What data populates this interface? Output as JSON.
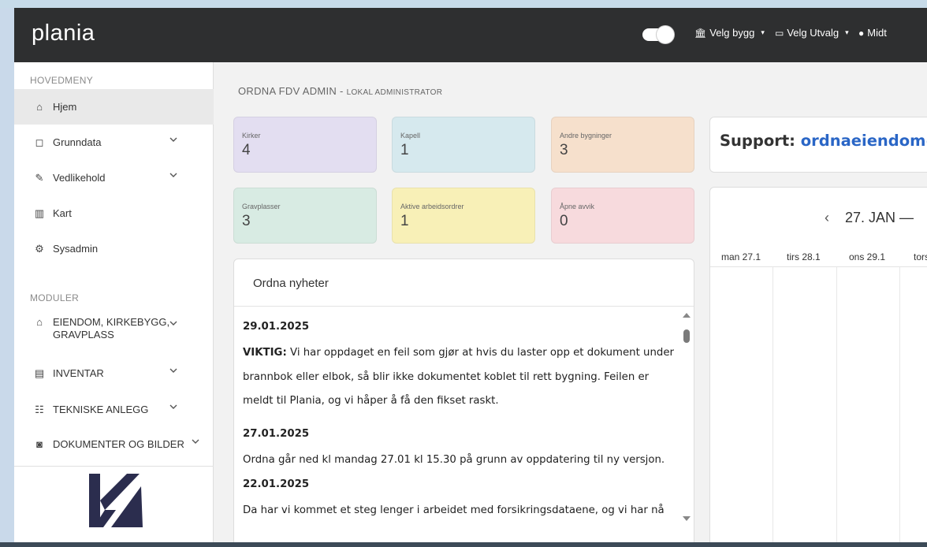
{
  "header": {
    "logo": "plania",
    "menu": [
      {
        "icon": "bank-icon",
        "glyph": "🏛",
        "label": "Velg bygg"
      },
      {
        "icon": "monitor-icon",
        "glyph": "▭",
        "label": "Velg Utvalg"
      },
      {
        "icon": "user-icon",
        "glyph": "●",
        "label": "Midt"
      }
    ]
  },
  "sidebar": {
    "main_section": "HOVEDMENY",
    "main_items": [
      {
        "icon": "home-icon",
        "glyph": "⌂",
        "label": "Hjem",
        "active": true
      },
      {
        "icon": "document-icon",
        "glyph": "◻",
        "label": "Grunndata",
        "expandable": true
      },
      {
        "icon": "wrench-icon",
        "glyph": "✎",
        "label": "Vedlikehold",
        "expandable": true
      },
      {
        "icon": "map-icon",
        "glyph": "▥",
        "label": "Kart"
      },
      {
        "icon": "gear-icon",
        "glyph": "⚙",
        "label": "Sysadmin"
      }
    ],
    "modules_section": "MODULER",
    "module_items": [
      {
        "icon": "building-icon",
        "glyph": "⌂",
        "label": "EIENDOM, KIRKEBYGG, GRAVPLASS"
      },
      {
        "icon": "inventory-icon",
        "glyph": "▤",
        "label": "INVENTAR"
      },
      {
        "icon": "hierarchy-icon",
        "glyph": "☷",
        "label": "TEKNISKE ANLEGG"
      },
      {
        "icon": "camera-icon",
        "glyph": "◙",
        "label": "DOKUMENTER OG BILDER"
      }
    ]
  },
  "main": {
    "title": "ORDNA FDV ADMIN",
    "title_sep": " - ",
    "title_role": "LOKAL ADMINISTRATOR"
  },
  "stats": [
    {
      "label": "Kirker",
      "value": "4",
      "color": "#e3def1"
    },
    {
      "label": "Kapell",
      "value": "1",
      "color": "#d6e9ee"
    },
    {
      "label": "Andre bygninger",
      "value": "3",
      "color": "#f6e0cc"
    },
    {
      "label": "Gravplasser",
      "value": "3",
      "color": "#d8ebe3"
    },
    {
      "label": "Aktive arbeidsordrer",
      "value": "1",
      "color": "#f8f0b7"
    },
    {
      "label": "Åpne avvik",
      "value": "0",
      "color": "#f7dadd"
    }
  ],
  "news": {
    "heading": "Ordna nyheter",
    "items": [
      {
        "date": "29.01.2025",
        "bold": "VIKTIG:",
        "text": " Vi har oppdaget en feil som gjør at hvis du laster opp et dokument under brannbok eller elbok, så blir ikke dokumentet koblet til rett bygning. Feilen er meldt til Plania, og vi håper å få den fikset raskt."
      },
      {
        "date": "27.01.2025",
        "bold": "",
        "text": "Ordna går ned kl mandag 27.01 kl 15.30 på grunn av oppdatering til ny versjon."
      },
      {
        "date": "22.01.2025",
        "bold": "",
        "text": "Da har vi kommet et steg lenger i arbeidet med forsikringsdataene, og vi har nå"
      }
    ]
  },
  "support": {
    "label": "Support:",
    "email": "ordnaeiendom@"
  },
  "calendar": {
    "prev": "‹",
    "range": "27. JAN —",
    "days": [
      "man 27.1",
      "tirs 28.1",
      "ons 29.1",
      "tors"
    ]
  }
}
